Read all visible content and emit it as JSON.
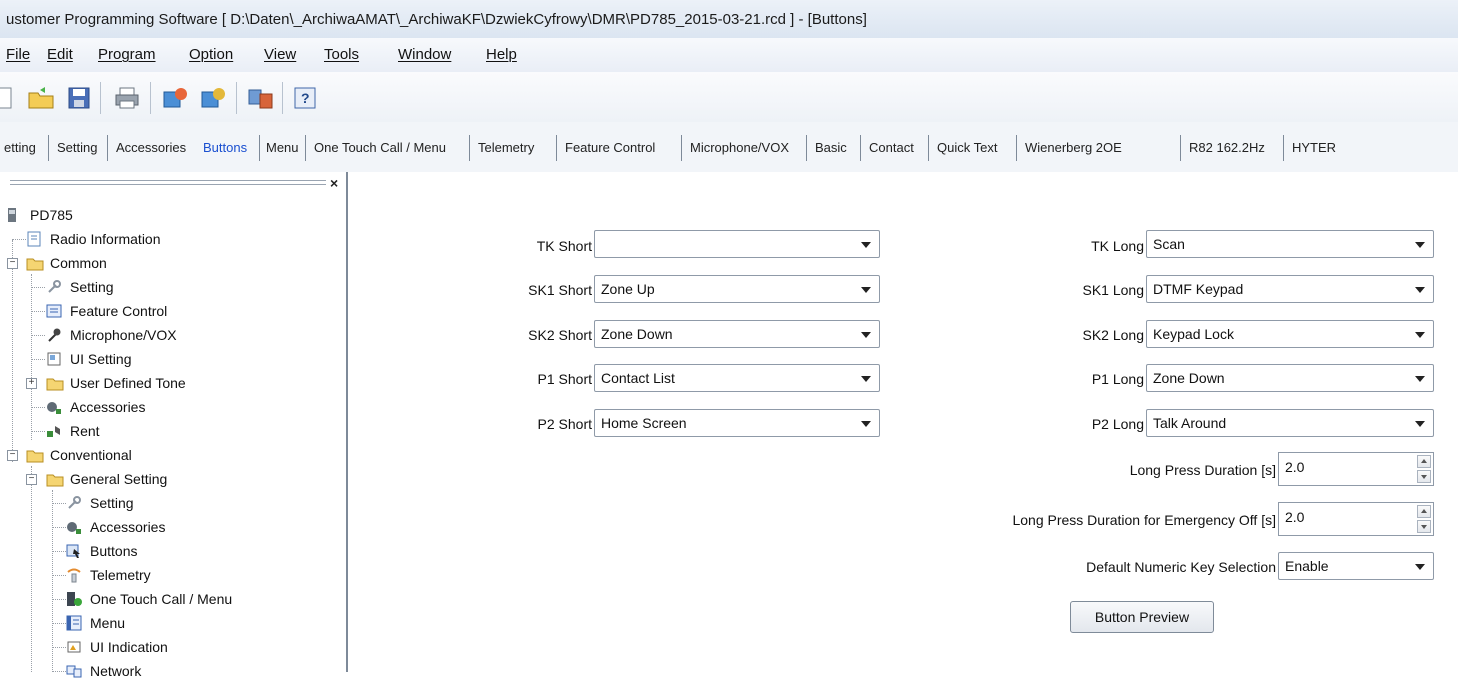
{
  "window": {
    "title": "ustomer Programming Software [ D:\\Daten\\_ArchiwaAMAT\\_ArchiwaKF\\DzwiekCyfrowy\\DMR\\PD785_2015-03-21.rcd ] - [Buttons]"
  },
  "menu": [
    "File",
    "Edit",
    "Program",
    "Option",
    "View",
    "Tools",
    "Window",
    "Help"
  ],
  "toolbar": {
    "icons": [
      "new-icon",
      "open-folder-icon",
      "save-icon",
      "print-icon",
      "read-radio-icon",
      "write-radio-icon",
      "transfer-icon",
      "help-icon"
    ]
  },
  "tabs": [
    "etting",
    "Setting",
    "Accessories",
    "Buttons",
    "Menu",
    "One Touch Call / Menu",
    "Telemetry",
    "Feature Control",
    "Microphone/VOX",
    "Basic",
    "Contact",
    "Quick Text",
    "Wienerberg  2OE",
    "R82 162.2Hz",
    "HYTER"
  ],
  "tree": {
    "root": "PD785",
    "items": [
      "Radio Information",
      "Common",
      "Setting",
      "Feature Control",
      "Microphone/VOX",
      "UI Setting",
      "User Defined Tone",
      "Accessories",
      "Rent",
      "Conventional",
      "General Setting",
      "Setting",
      "Accessories",
      "Buttons",
      "Telemetry",
      "One Touch Call / Menu",
      "Menu",
      "UI Indication",
      "Network"
    ]
  },
  "form": {
    "short": [
      {
        "label": "TK Short",
        "value": ""
      },
      {
        "label": "SK1 Short",
        "value": "Zone Up"
      },
      {
        "label": "SK2 Short",
        "value": "Zone Down"
      },
      {
        "label": "P1 Short",
        "value": "Contact List"
      },
      {
        "label": "P2 Short",
        "value": "Home Screen"
      }
    ],
    "long": [
      {
        "label": "TK Long",
        "value": "Scan"
      },
      {
        "label": "SK1 Long",
        "value": "DTMF Keypad"
      },
      {
        "label": "SK2 Long",
        "value": "Keypad Lock"
      },
      {
        "label": "P1 Long",
        "value": "Zone Down"
      },
      {
        "label": "P2 Long",
        "value": "Talk Around"
      }
    ],
    "long_press_label": "Long Press Duration [s]",
    "long_press_value": "2.0",
    "emergency_label": "Long Press Duration for Emergency Off [s]",
    "emergency_value": "2.0",
    "numeric_key_label": "Default Numeric Key Selection",
    "numeric_key_value": "Enable",
    "preview_button": "Button Preview"
  },
  "colors": {
    "active_tab": "#1a4fd0",
    "titlebar": "#dbe5f1"
  }
}
